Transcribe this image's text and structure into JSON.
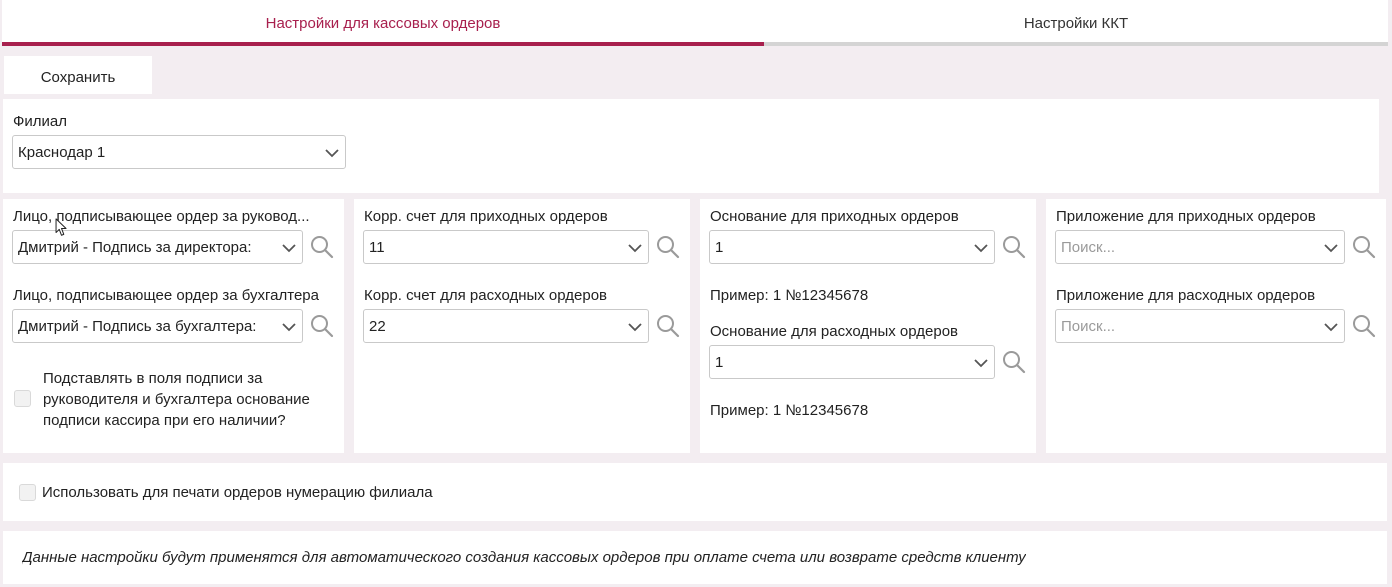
{
  "tabs": [
    {
      "label": "Настройки для кассовых ордеров",
      "active": true
    },
    {
      "label": "Настройки ККТ",
      "active": false
    }
  ],
  "colors": {
    "accent": "#a8204e",
    "inactive_bar": "#d4d4d4",
    "background": "#f3edf1"
  },
  "toolbar": {
    "save_label": "Сохранить"
  },
  "branch": {
    "label": "Филиал",
    "value": "Краснодар 1"
  },
  "signers": {
    "director_label": "Лицо, подписывающее ордер за руковод...",
    "director_value": "Дмитрий - Подпись за директора:",
    "accountant_label": "Лицо, подписывающее ордер за бухгалтера",
    "accountant_value": "Дмитрий - Подпись за бухгалтера:",
    "substitute_text": "Подставлять в поля подписи за руководителя и бухгалтера основание подписи кассира при его наличии?"
  },
  "accounts": {
    "income_label": "Корр. счет для приходных ордеров",
    "income_value": "11",
    "expense_label": "Корр. счет для расходных ордеров",
    "expense_value": "22"
  },
  "basis": {
    "income_label": "Основание для приходных ордеров",
    "income_value": "1",
    "income_example": "Пример: 1 №12345678",
    "expense_label": "Основание для расходных ордеров",
    "expense_value": "1",
    "expense_example": "Пример: 1 №12345678"
  },
  "attachments": {
    "income_label": "Приложение для приходных ордеров",
    "income_placeholder": "Поиск...",
    "expense_label": "Приложение для расходных ордеров",
    "expense_placeholder": "Поиск..."
  },
  "numbering": {
    "label": "Использовать для печати ордеров нумерацию филиала"
  },
  "note": {
    "text": "Данные настройки будут применятся для автоматического создания кассовых ордеров при оплате счета или возврате средств клиенту"
  }
}
